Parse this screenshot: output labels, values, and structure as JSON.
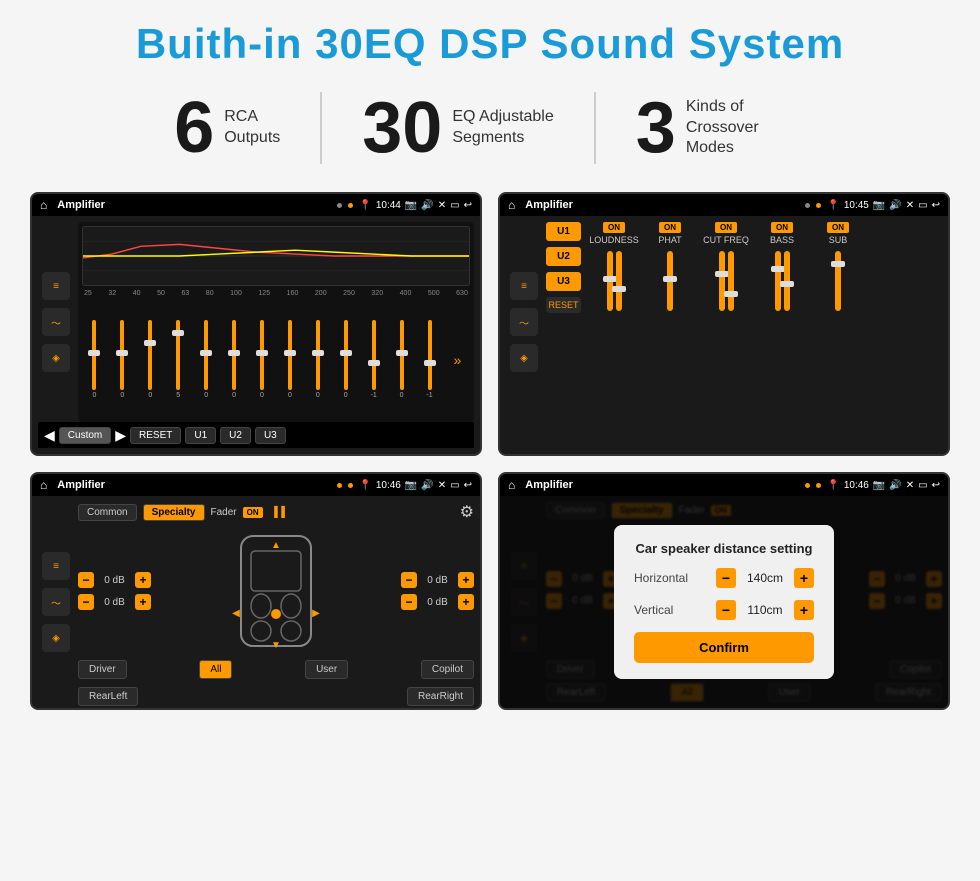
{
  "header": {
    "title": "Buith-in 30EQ DSP Sound System"
  },
  "stats": [
    {
      "number": "6",
      "label": "RCA\nOutputs"
    },
    {
      "number": "30",
      "label": "EQ Adjustable\nSegments"
    },
    {
      "number": "3",
      "label": "Kinds of\nCrossover Modes"
    }
  ],
  "screens": {
    "eq": {
      "app_name": "Amplifier",
      "time": "10:44",
      "freq_labels": [
        "25",
        "32",
        "40",
        "50",
        "63",
        "80",
        "100",
        "125",
        "160",
        "200",
        "250",
        "320",
        "400",
        "500",
        "630"
      ],
      "values": [
        "0",
        "0",
        "0",
        "5",
        "0",
        "0",
        "0",
        "0",
        "0",
        "0",
        "-1",
        "0",
        "-1"
      ],
      "buttons": [
        "Custom",
        "RESET",
        "U1",
        "U2",
        "U3"
      ]
    },
    "crossover": {
      "app_name": "Amplifier",
      "time": "10:45",
      "presets": [
        "U1",
        "U2",
        "U3"
      ],
      "channels": [
        "LOUDNESS",
        "PHAT",
        "CUT FREQ",
        "BASS",
        "SUB"
      ],
      "reset_label": "RESET"
    },
    "fader": {
      "app_name": "Amplifier",
      "time": "10:46",
      "modes": [
        "Common",
        "Specialty"
      ],
      "fader_label": "Fader",
      "on_label": "ON",
      "db_values": [
        "0 dB",
        "0 dB",
        "0 dB",
        "0 dB"
      ],
      "bottom_btns": [
        "Driver",
        "All",
        "User",
        "RearLeft",
        "Copilot",
        "RearRight"
      ]
    },
    "dialog": {
      "app_name": "Amplifier",
      "time": "10:46",
      "modes": [
        "Common",
        "Specialty"
      ],
      "dialog_title": "Car speaker distance setting",
      "horizontal_label": "Horizontal",
      "horizontal_value": "140cm",
      "vertical_label": "Vertical",
      "vertical_value": "110cm",
      "confirm_label": "Confirm",
      "bottom_btns": [
        "Driver",
        "RearLeft",
        "User",
        "Copilot",
        "RearRight"
      ]
    }
  },
  "colors": {
    "accent": "#f90",
    "blue": "#1a9ad7",
    "bg_dark": "#1a1a1a",
    "text_light": "#ccc"
  }
}
